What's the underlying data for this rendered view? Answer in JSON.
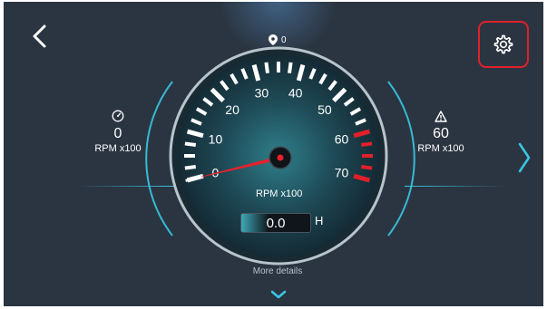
{
  "location": {
    "count": "0"
  },
  "left_panel": {
    "value": "0",
    "unit": "RPM x100",
    "icon": "gauge-icon"
  },
  "right_panel": {
    "value": "60",
    "unit": "RPM x100",
    "icon": "warning-icon"
  },
  "gauge": {
    "ticks": [
      {
        "label": "0",
        "value": 0
      },
      {
        "label": "10",
        "value": 10
      },
      {
        "label": "20",
        "value": 20
      },
      {
        "label": "30",
        "value": 30
      },
      {
        "label": "40",
        "value": 40
      },
      {
        "label": "50",
        "value": 50
      },
      {
        "label": "60",
        "value": 60
      },
      {
        "label": "70",
        "value": 70
      }
    ],
    "current_value": 0,
    "red_zone_start": 60,
    "unit": "RPM x100",
    "hours_value": "0.0",
    "hours_unit": "H"
  },
  "more_details": "More details",
  "colors": {
    "background": "#2b3541",
    "accent": "#38c8e6",
    "danger": "#e0202a",
    "needle": "#e8202a"
  }
}
